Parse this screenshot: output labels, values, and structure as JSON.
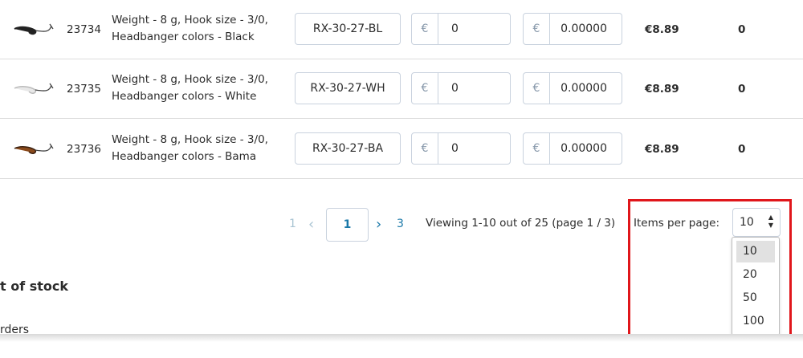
{
  "products": [
    {
      "id": "23734",
      "desc_line1": "Weight - 8 g, Hook size - 3/0,",
      "desc_line2": "Headbanger colors - Black",
      "sku": "RX-30-27-BL",
      "field1": "0",
      "field2": "0.00000",
      "price": "€8.89",
      "qty": "0",
      "thumb_color": "#222222"
    },
    {
      "id": "23735",
      "desc_line1": "Weight - 8 g, Hook size - 3/0,",
      "desc_line2": "Headbanger colors - White",
      "sku": "RX-30-27-WH",
      "field1": "0",
      "field2": "0.00000",
      "price": "€8.89",
      "qty": "0",
      "thumb_color": "#e8e8e8"
    },
    {
      "id": "23736",
      "desc_line1": "Weight - 8 g, Hook size - 3/0,",
      "desc_line2": "Headbanger colors - Bama",
      "sku": "RX-30-27-BA",
      "field1": "0",
      "field2": "0.00000",
      "price": "€8.89",
      "qty": "0",
      "thumb_color": "#8a4a1c"
    }
  ],
  "currency_symbol": "€",
  "pagination": {
    "first": "1",
    "prev_icon": "chevron-left-icon",
    "current": "1",
    "next_icon": "chevron-right-icon",
    "last": "3",
    "viewing": "Viewing 1-10 out of 25 (page 1 / 3)",
    "items_per_page_label": "Items per page:",
    "items_per_page_value": "10",
    "items_per_page_options": [
      "10",
      "20",
      "50",
      "100"
    ]
  },
  "sidebar": {
    "heading_fragment": "t of stock",
    "link_fragment": "rders"
  },
  "colors": {
    "accent": "#1a78a8",
    "highlight": "#e0161b"
  }
}
